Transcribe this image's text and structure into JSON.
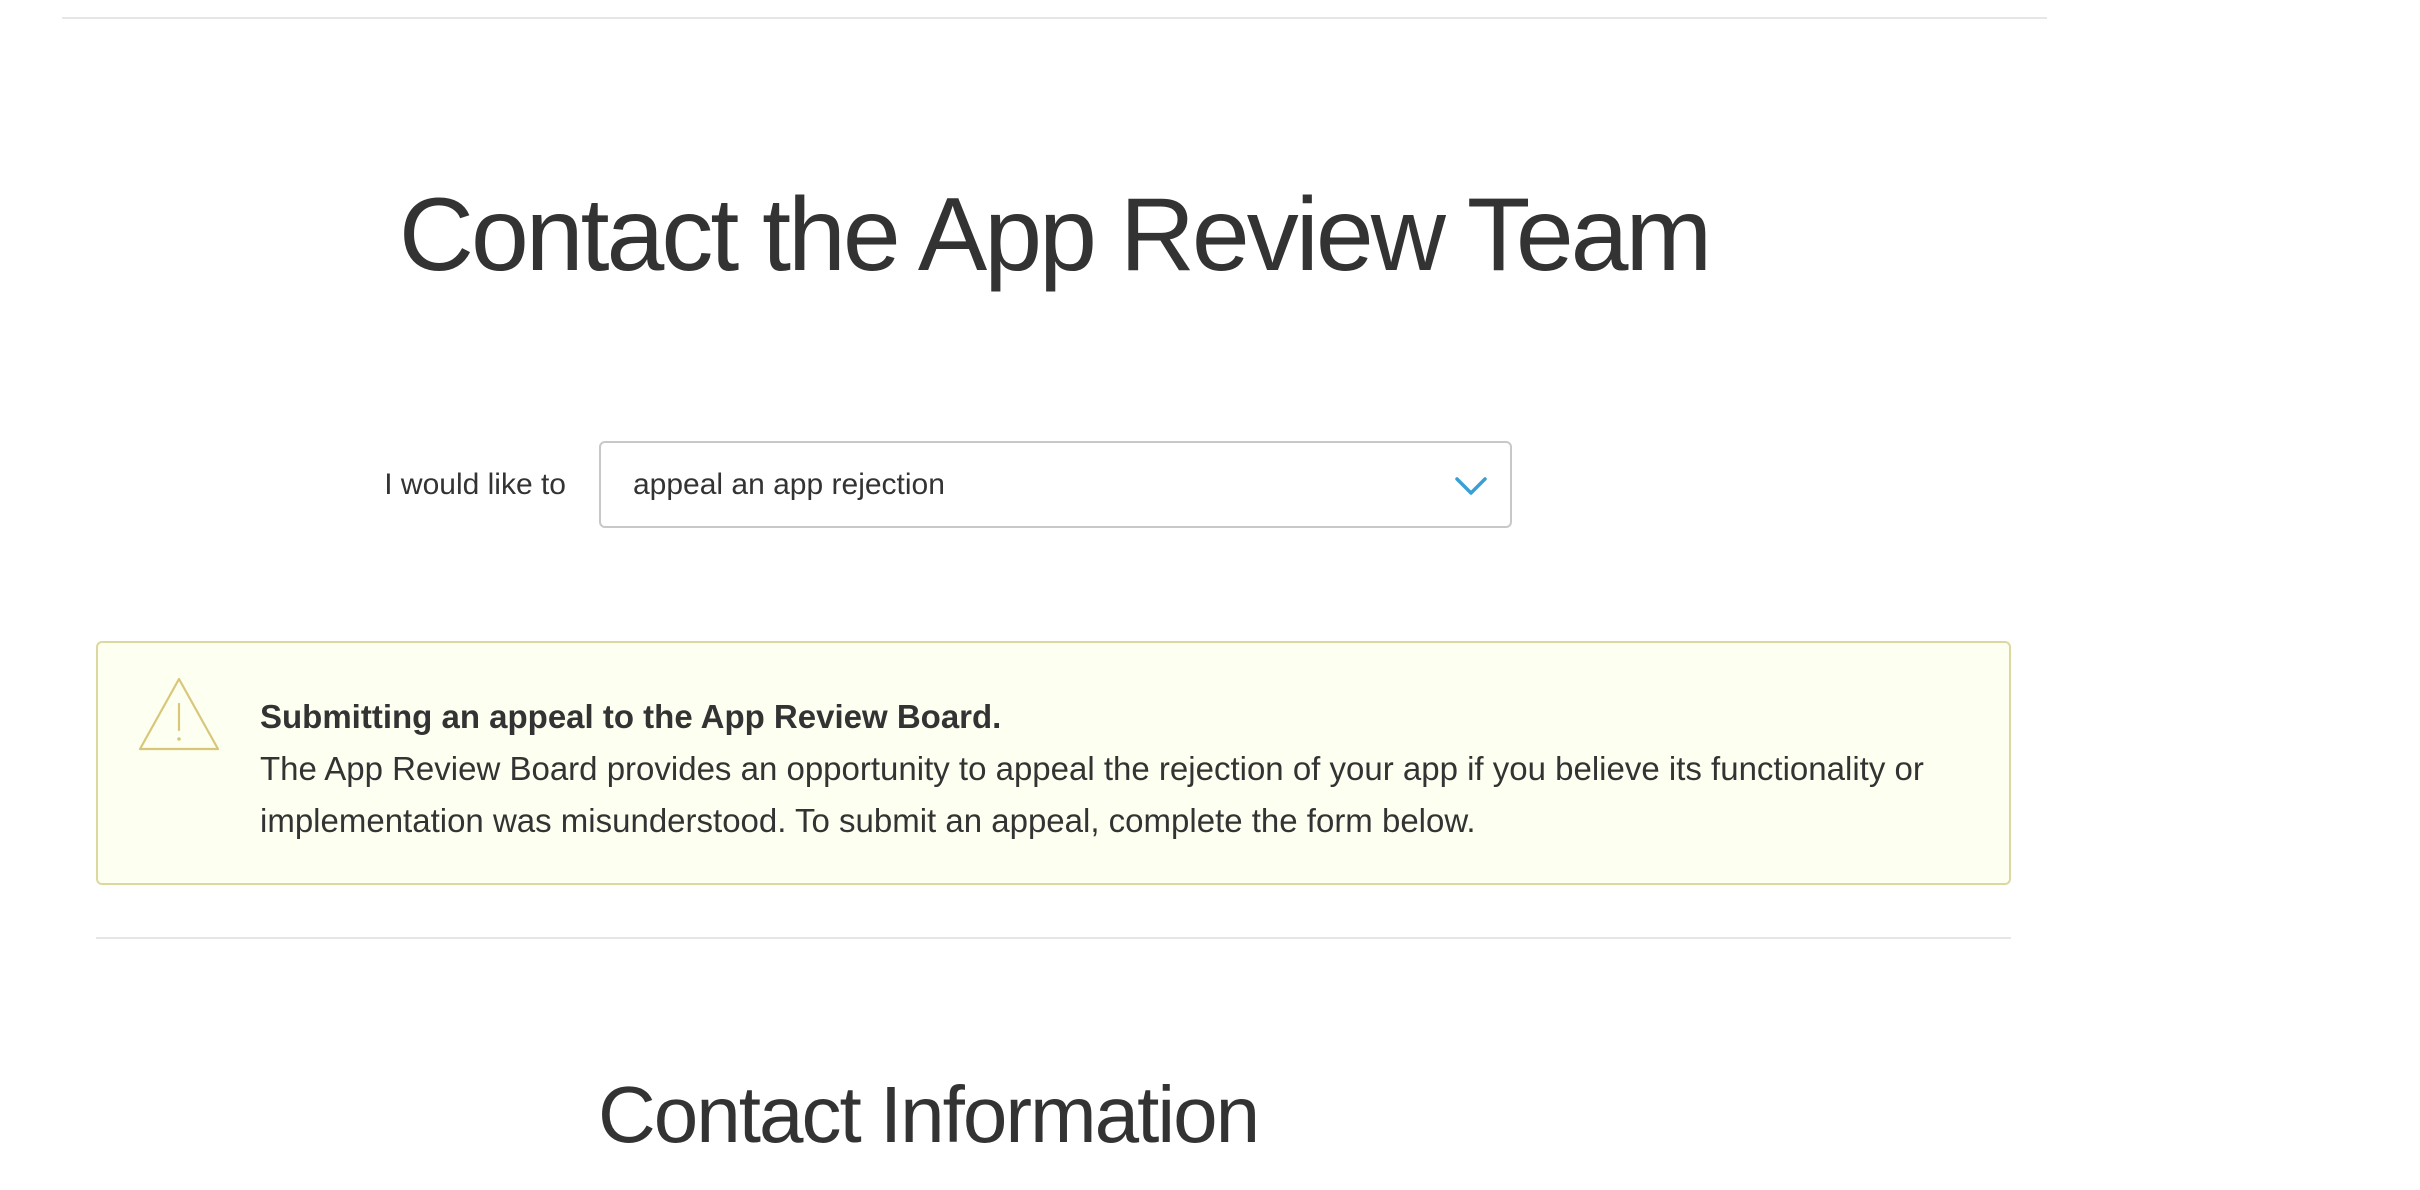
{
  "page": {
    "title": "Contact the App Review Team"
  },
  "reason": {
    "label": "I would like to",
    "selected": "appeal an app rejection",
    "chevron_icon": "chevron-down-icon",
    "chevron_color": "#3a9fd5"
  },
  "notice": {
    "icon": "warning-triangle-icon",
    "icon_color": "#d8c77a",
    "heading": "Submitting an appeal to the App Review Board.",
    "body": "The App Review Board provides an opportunity to appeal the rejection of your app if you believe its functionality or implementation was misunderstood. To submit an appeal, complete the form below.",
    "background": "#fdfff0",
    "border_color": "#ddd8a0"
  },
  "contact_section": {
    "title": "Contact Information"
  }
}
